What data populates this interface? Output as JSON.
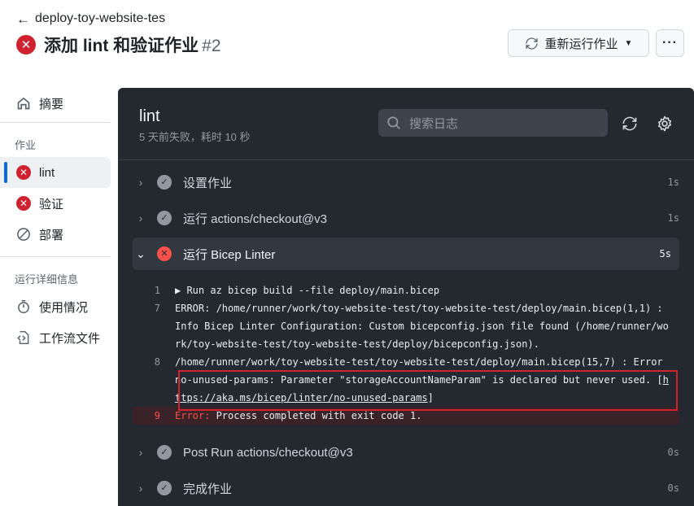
{
  "header": {
    "back_label": "deploy-toy-website-tes",
    "title": "添加 lint 和验证作业",
    "run_number": "#2",
    "rerun_label": "重新运行作业",
    "more_label": "···"
  },
  "sidebar": {
    "summary_label": "摘要",
    "jobs_heading": "作业",
    "jobs": [
      {
        "label": "lint"
      },
      {
        "label": "验证"
      },
      {
        "label": "部署"
      }
    ],
    "details_heading": "运行详细信息",
    "details": [
      {
        "label": "使用情况"
      },
      {
        "label": "工作流文件"
      }
    ]
  },
  "panel": {
    "job_name": "lint",
    "job_meta": "5 天前失败，耗时 10 秒",
    "search_placeholder": "搜索日志",
    "steps": [
      {
        "name": "设置作业",
        "duration": "1s",
        "status": "success"
      },
      {
        "name": "运行 actions/checkout@v3",
        "duration": "1s",
        "status": "success"
      },
      {
        "name": "运行 Bicep Linter",
        "duration": "5s",
        "status": "failure"
      },
      {
        "name": "Post Run actions/checkout@v3",
        "duration": "0s",
        "status": "success"
      },
      {
        "name": "完成作业",
        "duration": "0s",
        "status": "success"
      }
    ],
    "log": [
      {
        "line": "1",
        "text": "▶ Run az bicep build --file deploy/main.bicep"
      },
      {
        "line": "7",
        "text": "ERROR: /home/runner/work/toy-website-test/toy-website-test/deploy/main.bicep(1,1) : Info Bicep Linter Configuration: Custom bicepconfig.json file found (/home/runner/work/toy-website-test/toy-website-test/deploy/bicepconfig.json)."
      },
      {
        "line": "8",
        "text_prefix": "/home/runner/work/toy-website-test/toy-website-test/deploy/main.bicep(15,7) : Error no-unused-params: Parameter \"storageAccountNameParam\" is declared but never used. [",
        "link": "https://aka.ms/bicep/linter/no-unused-params",
        "text_suffix": "]"
      },
      {
        "line": "9",
        "keyword": "Error:",
        "text": " Process completed with exit code 1."
      }
    ]
  },
  "colors": {
    "failure": "#cf222e",
    "panel_bg": "#24292f",
    "highlight": "#d1242f",
    "active_indicator": "#0969da"
  }
}
